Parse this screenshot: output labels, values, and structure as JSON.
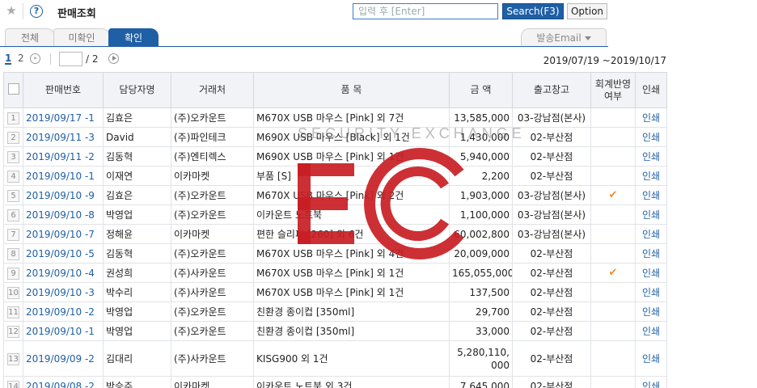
{
  "header": {
    "title": "판매조회",
    "search_placeholder": "입력 후 [Enter]",
    "search_label": "Search(F3)",
    "option_label": "Option"
  },
  "tabs": [
    {
      "label": "전체"
    },
    {
      "label": "미확인"
    },
    {
      "label": "확인"
    }
  ],
  "send_email_label": "발송Email",
  "pager": {
    "pages": [
      "1",
      "2"
    ],
    "current_input": "",
    "total": "/ 2",
    "date_range": "2019/07/19 ~2019/10/17"
  },
  "table": {
    "columns": [
      "판매번호",
      "담당자명",
      "거래처",
      "품 목",
      "금 액",
      "출고창고",
      "회계반영 여부",
      "인쇄"
    ],
    "rows": [
      {
        "n": "1",
        "sale_no": "2019/09/17 -1",
        "manager": "김효은",
        "client": "(주)오카운트",
        "item": "M670X USB 마우스 [Pink] 외 7건",
        "amount": "13,585,000",
        "warehouse": "03-강남점(본사)",
        "acc": "",
        "print": "인쇄"
      },
      {
        "n": "2",
        "sale_no": "2019/09/11 -3",
        "manager": "David",
        "client": "(주)파인테크",
        "item": "M690X USB 마우스 [Black] 외 1건",
        "amount": "1,430,000",
        "warehouse": "02-부산점",
        "acc": "",
        "print": "인쇄"
      },
      {
        "n": "3",
        "sale_no": "2019/09/11 -2",
        "manager": "김동혁",
        "client": "(주)엔티렉스",
        "item": "M690X USB 마우스 [Pink] 외 1건",
        "amount": "5,940,000",
        "warehouse": "02-부산점",
        "acc": "",
        "print": "인쇄"
      },
      {
        "n": "4",
        "sale_no": "2019/09/10 -1",
        "manager": "이재연",
        "client": "이카마켓",
        "item": "부품 [S]",
        "amount": "2,200",
        "warehouse": "02-부산점",
        "acc": "",
        "print": "인쇄"
      },
      {
        "n": "5",
        "sale_no": "2019/09/10 -9",
        "manager": "김효은",
        "client": "(주)오카운트",
        "item": "M670X USB 마우스 [Pink] 외 2건",
        "amount": "1,903,000",
        "warehouse": "03-강남점(본사)",
        "acc": "✔",
        "print": "인쇄"
      },
      {
        "n": "6",
        "sale_no": "2019/09/10 -8",
        "manager": "박영업",
        "client": "(주)오카운트",
        "item": "이카운트 노트북",
        "amount": "1,100,000",
        "warehouse": "03-강남점(본사)",
        "acc": "",
        "print": "인쇄"
      },
      {
        "n": "7",
        "sale_no": "2019/09/10 -7",
        "manager": "정해윤",
        "client": "이카마켓",
        "item": "편한 슬리퍼 [260] 외 6건",
        "amount": "60,002,800",
        "warehouse": "03-강남점(본사)",
        "acc": "",
        "print": "인쇄"
      },
      {
        "n": "8",
        "sale_no": "2019/09/10 -5",
        "manager": "김동혁",
        "client": "(주)오카운트",
        "item": "M670X USB 마우스 [Pink] 외 4건",
        "amount": "20,009,000",
        "warehouse": "02-부산점",
        "acc": "",
        "print": "인쇄"
      },
      {
        "n": "9",
        "sale_no": "2019/09/10 -4",
        "manager": "권성희",
        "client": "(주)사카운트",
        "item": "M670X USB 마우스 [Pink] 외 1건",
        "amount": "165,055,000",
        "warehouse": "02-부산점",
        "acc": "✔",
        "print": "인쇄"
      },
      {
        "n": "10",
        "sale_no": "2019/09/10 -3",
        "manager": "박수리",
        "client": "(주)사카운트",
        "item": "M670X USB 마우스 [Pink] 외 1건",
        "amount": "137,500",
        "warehouse": "02-부산점",
        "acc": "",
        "print": "인쇄"
      },
      {
        "n": "11",
        "sale_no": "2019/09/10 -2",
        "manager": "박영업",
        "client": "(주)오카운트",
        "item": "친환경 종이컵 [350ml]",
        "amount": "29,700",
        "warehouse": "02-부산점",
        "acc": "",
        "print": "인쇄"
      },
      {
        "n": "12",
        "sale_no": "2019/09/10 -1",
        "manager": "박영업",
        "client": "(주)오카운트",
        "item": "친환경 종이컵 [350ml]",
        "amount": "33,000",
        "warehouse": "02-부산점",
        "acc": "",
        "print": "인쇄"
      },
      {
        "n": "13",
        "sale_no": "2019/09/09 -2",
        "manager": "김대리",
        "client": "(주)사카운트",
        "item": "KISG900 외 1건",
        "amount": "5,280,110,000",
        "warehouse": "02-부산점",
        "acc": "",
        "print": "인쇄",
        "tall": true
      },
      {
        "n": "14",
        "sale_no": "2019/09/08 -2",
        "manager": "박승주",
        "client": "이카마켓",
        "item": "이카운트 노트북 외 3건",
        "amount": "7,645,000",
        "warehouse": "02-부산점",
        "acc": "",
        "print": "인쇄"
      }
    ]
  },
  "watermark": {
    "text": "SECURITY EXCHANGE",
    "color": "#c81e24"
  },
  "colors": {
    "accent": "#1f5fa5",
    "check": "#f08c2a"
  }
}
